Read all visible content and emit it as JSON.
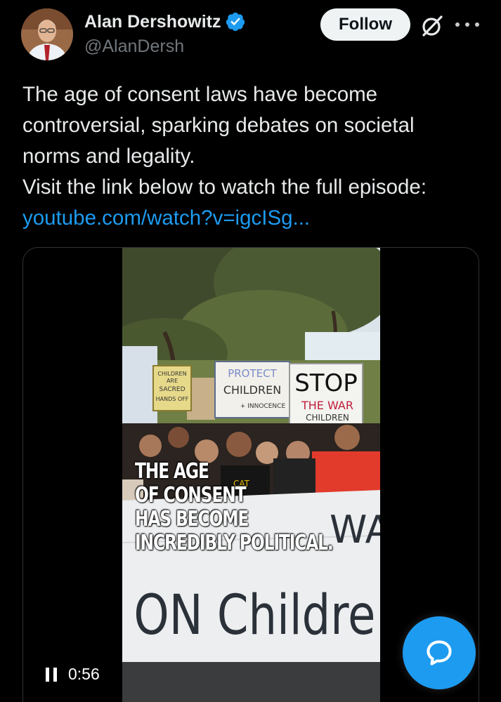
{
  "author": {
    "name": "Alan Dershowitz",
    "handle": "@AlanDersh",
    "verified_color": "#1d9bf0"
  },
  "actions": {
    "follow_label": "Follow",
    "grok_icon": "grok-icon",
    "more_icon": "more-options-icon"
  },
  "tweet": {
    "lines": [
      "The age of consent laws have become",
      "controversial, sparking debates on societal",
      "norms and legality.",
      "Visit the link below to watch the full episode:"
    ],
    "link": "youtube.com/watch?v=igcISg..."
  },
  "video": {
    "overlay_lines": [
      "THE AGE",
      "OF CONSENT",
      "HAS BECOME",
      "INCREDIBLY POLITICAL."
    ],
    "banner_text": "ON Childre",
    "banner_partial": "WA",
    "signs": {
      "sign1": [
        "CHILDREN",
        "ARE",
        "SACRED",
        "HANDS OFF"
      ],
      "sign2": [
        "PROTECT",
        "CHILDREN",
        "+ INNOCENCE"
      ],
      "sign3": [
        "STOP",
        "THE WAR",
        "CHILDREN"
      ]
    },
    "cap_text": "CAT",
    "time": "0:56",
    "state": "playing"
  },
  "fab": {
    "icon": "reply-bubble-icon",
    "color": "#1d9bf0"
  },
  "colors": {
    "background": "#000000",
    "text": "#e7e9ea",
    "muted": "#71767b",
    "accent": "#1d9bf0"
  }
}
